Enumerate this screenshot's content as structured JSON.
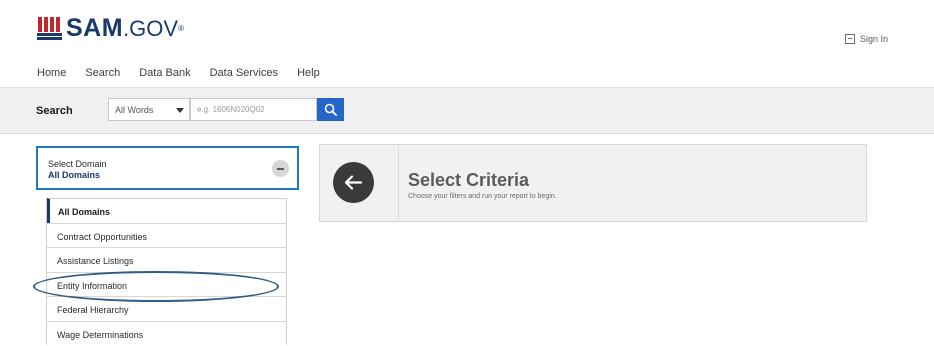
{
  "header": {
    "logo_text": "SAM",
    "logo_gov": ".GOV",
    "logo_reg": "®",
    "signin_label": "Sign In"
  },
  "nav": {
    "items": [
      {
        "label": "Home",
        "active": false
      },
      {
        "label": "Search",
        "active": true
      },
      {
        "label": "Data Bank",
        "active": false
      },
      {
        "label": "Data Services",
        "active": false
      },
      {
        "label": "Help",
        "active": false
      }
    ]
  },
  "search": {
    "label": "Search",
    "scope_value": "All Words",
    "placeholder": "e.g. 1606N020Q02"
  },
  "domain_selector": {
    "title": "Select Domain",
    "value": "All Domains",
    "items": [
      {
        "label": "All Domains"
      },
      {
        "label": "Contract Opportunities"
      },
      {
        "label": "Assistance Listings"
      },
      {
        "label": "Entity Information"
      },
      {
        "label": "Federal Hierarchy"
      },
      {
        "label": "Wage Determinations"
      }
    ]
  },
  "criteria": {
    "title": "Select Criteria",
    "subtitle": "Choose your filters and run your report to begin."
  },
  "icons": {
    "logo": "capitol-flag-icon",
    "signin": "sign-in-icon",
    "search": "search-icon",
    "collapse": "minus-circle-icon",
    "back": "arrow-left-icon"
  },
  "colors": {
    "brand_navy": "#1a3a6b",
    "nav_active": "#2fa36b",
    "search_button": "#2566c8",
    "domain_border": "#2378c3",
    "highlight_ellipse": "#2f5d86"
  }
}
